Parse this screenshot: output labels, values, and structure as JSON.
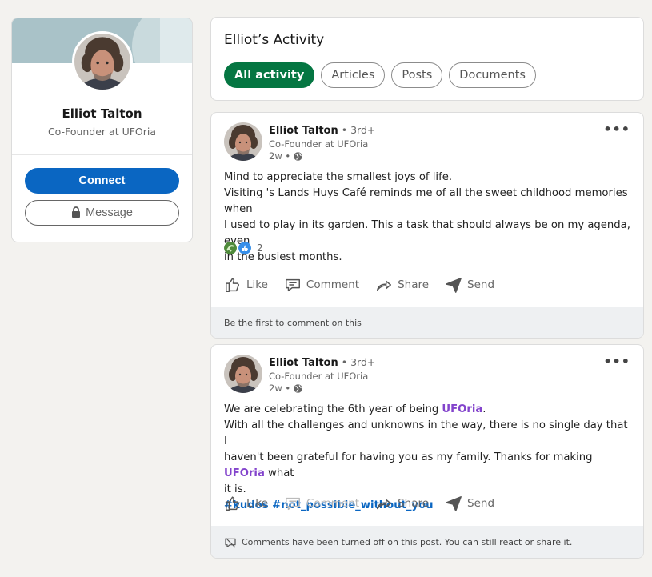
{
  "profile": {
    "name": "Elliot Talton",
    "headline": "Co-Founder at UFOria",
    "connect_label": "Connect",
    "message_label": "Message"
  },
  "activity": {
    "title": "Elliot’s Activity",
    "tabs": [
      "All activity",
      "Articles",
      "Posts",
      "Documents"
    ],
    "active_tab": "All activity"
  },
  "posts": [
    {
      "author": "Elliot Talton",
      "degree": " • 3rd+",
      "headline": "Co-Founder at UFOria",
      "time": "2w •",
      "lines": [
        "Mind to appreciate the smallest joys of life.",
        "Visiting 's Lands Huys Café reminds me of all the sweet childhood memories when",
        "I used to play in its garden. This a task that should always be on my agenda, even",
        "in the busiest months."
      ],
      "reaction_count": "2",
      "actions": {
        "like": "Like",
        "comment": "Comment",
        "share": "Share",
        "send": "Send"
      },
      "footer": "Be the first to comment on this"
    },
    {
      "author": "Elliot Talton",
      "degree": " • 3rd+",
      "headline": "Co-Founder at UFOria",
      "time": "2w •",
      "line1_pre": "We are celebrating the 6th year of being ",
      "line1_link": "UFOria",
      "line1_post": ".",
      "line2": "With all the challenges and unknowns in the way, there is no single day that I",
      "line3_pre": "haven't been grateful for having you as my family. Thanks for making ",
      "line3_link": "UFOria",
      "line3_post": " what",
      "line4": "it is.",
      "hashtags": "#kudos #not_possible_without_you",
      "actions": {
        "like": "Like",
        "comment": "Comment",
        "share": "Share",
        "send": "Send"
      },
      "footer": "Comments have been turned off on this post. You can still react or share it."
    }
  ],
  "icons": {
    "globe": "globe-icon",
    "lock": "lock-icon",
    "like": "thumbs-up-icon",
    "comment": "comment-bubble-icon",
    "share": "share-arrow-icon",
    "send": "paper-plane-icon",
    "comments_off": "comments-off-icon"
  },
  "colors": {
    "primary": "#0a66c2",
    "active_tab": "#057642",
    "mention_link": "#8344cc"
  }
}
